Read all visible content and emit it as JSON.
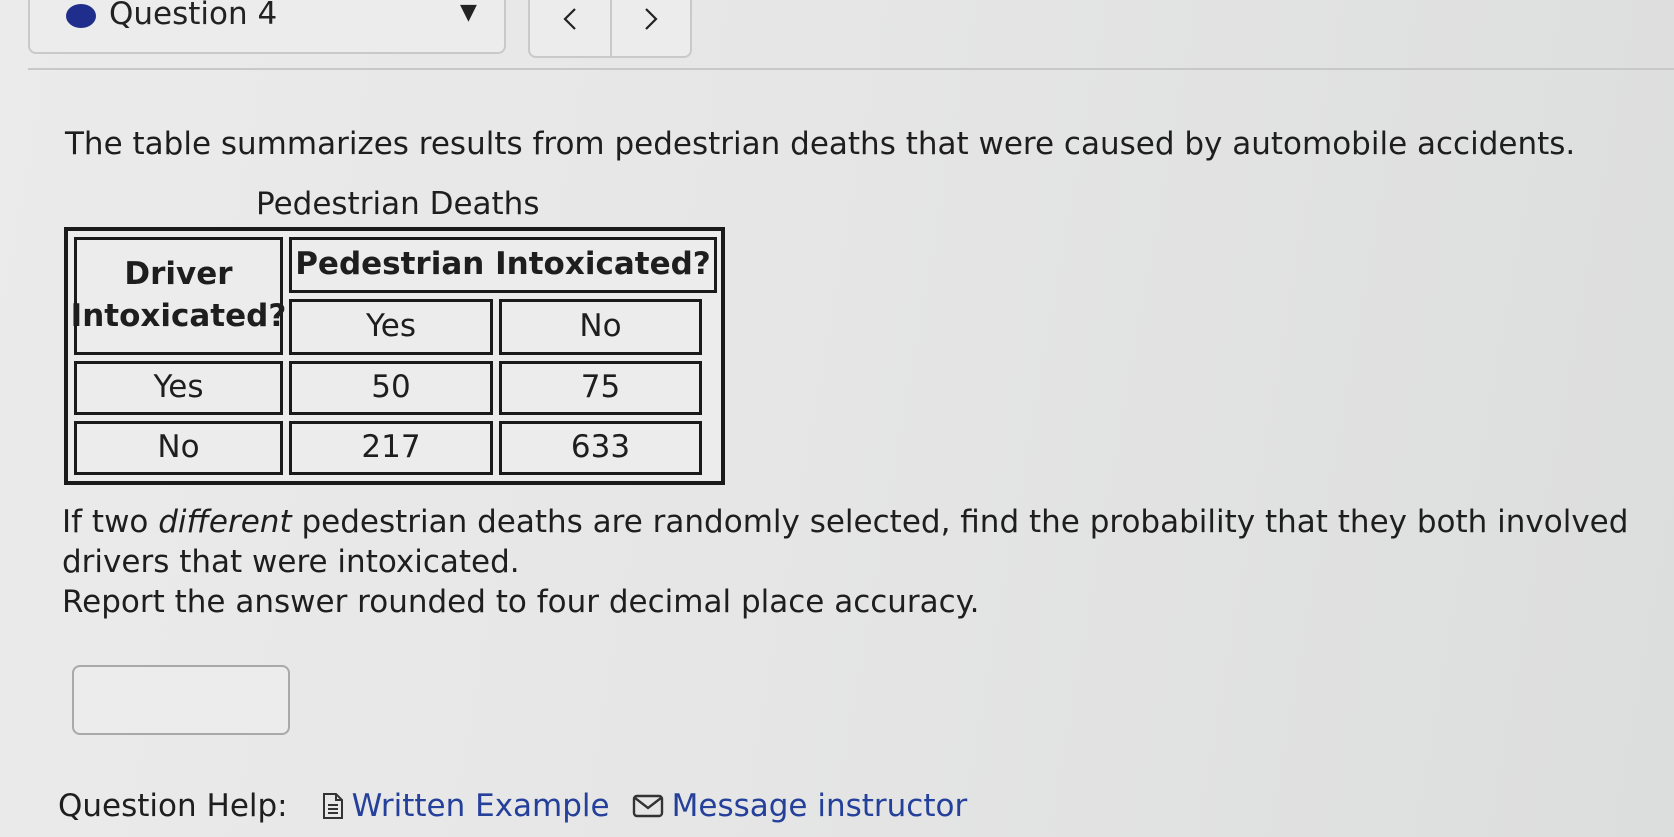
{
  "nav": {
    "question_label": "Question 4",
    "dropdown_icon": "caret-down-icon",
    "prev_icon": "chevron-left-icon",
    "next_icon": "chevron-right-icon",
    "status_color": "#1f2e8c"
  },
  "intro": "The table summarizes results from pedestrian deaths that were caused by automobile accidents.",
  "table": {
    "caption": "Pedestrian Deaths",
    "row_header": "Driver Intoxicated?",
    "col_group_header": "Pedestrian Intoxicated?",
    "col_headers": [
      "Yes",
      "No"
    ],
    "rows": [
      {
        "label": "Yes",
        "values": [
          "50",
          "75"
        ]
      },
      {
        "label": "No",
        "values": [
          "217",
          "633"
        ]
      }
    ]
  },
  "question": {
    "part1": "If two ",
    "emphasis": "different",
    "part2": " pedestrian deaths are randomly selected, find the probability that they both involved drivers that were intoxicated.",
    "instruction": "Report the answer rounded to four decimal place accuracy."
  },
  "answer": {
    "value": ""
  },
  "help": {
    "label": "Question Help:",
    "written_example": "Written Example",
    "message_instructor": "Message instructor",
    "link_color": "#24409a"
  }
}
